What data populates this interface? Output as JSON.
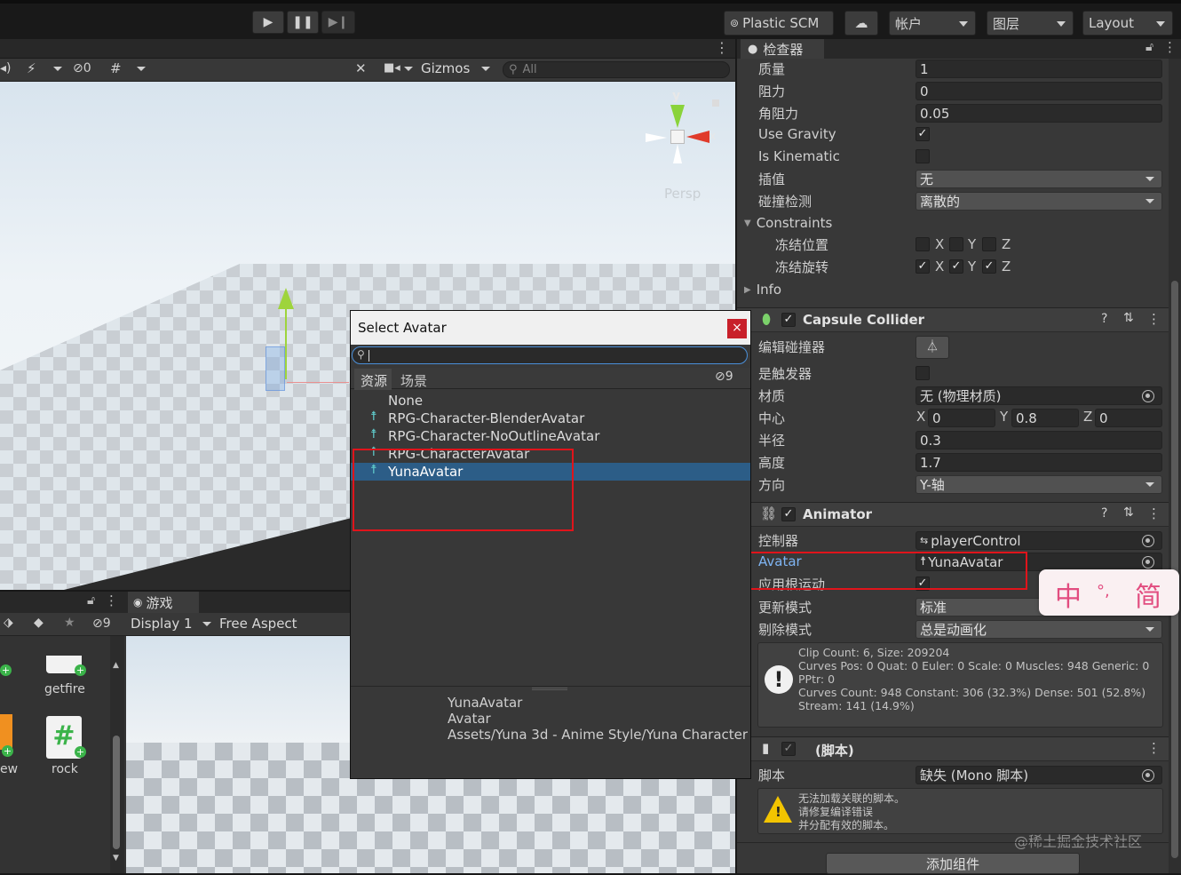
{
  "toolbar": {
    "plastic_scm": "Plastic SCM",
    "account": "帐户",
    "layers": "图层",
    "layout": "Layout"
  },
  "scene_toolbar": {
    "hidden_count": "0",
    "gizmos": "Gizmos",
    "search_placeholder": "All"
  },
  "scene": {
    "axis_y": "y",
    "axis_x": "x",
    "persp": "Persp"
  },
  "inspector": {
    "tab": "检查器",
    "rows": {
      "mass": {
        "label": "质量",
        "value": "1"
      },
      "drag": {
        "label": "阻力",
        "value": "0"
      },
      "angular_drag": {
        "label": "角阻力",
        "value": "0.05"
      },
      "use_gravity": {
        "label": "Use Gravity"
      },
      "is_kinematic": {
        "label": "Is Kinematic"
      },
      "interpolate": {
        "label": "插值",
        "value": "无"
      },
      "collision": {
        "label": "碰撞检测",
        "value": "离散的"
      },
      "constraints": {
        "label": "Constraints"
      },
      "freeze_pos": {
        "label": "冻结位置"
      },
      "freeze_rot": {
        "label": "冻结旋转"
      },
      "info": {
        "label": "Info"
      }
    },
    "axes": {
      "x": "X",
      "y": "Y",
      "z": "Z"
    },
    "capsule": {
      "title": "Capsule Collider",
      "edit_label": "编辑碰撞器",
      "trigger_label": "是触发器",
      "material_label": "材质",
      "material_value": "无 (物理材质)",
      "center_label": "中心",
      "center_x": "0",
      "center_y": "0.8",
      "center_z": "0",
      "radius_label": "半径",
      "radius_value": "0.3",
      "height_label": "高度",
      "height_value": "1.7",
      "direction_label": "方向",
      "direction_value": "Y-轴"
    },
    "animator": {
      "title": "Animator",
      "controller_label": "控制器",
      "controller_value": "playerControl",
      "avatar_label": "Avatar",
      "avatar_value": "YunaAvatar",
      "root_motion_label": "应用根运动",
      "update_label": "更新模式",
      "update_value": "标准",
      "culling_label": "剔除模式",
      "culling_value": "总是动画化",
      "info": [
        "Clip Count: 6, Size: 209204",
        "Curves Pos: 0 Quat: 0 Euler: 0 Scale: 0 Muscles: 948 Generic: 0",
        "PPtr: 0",
        "Curves Count: 948 Constant: 306 (32.3%) Dense: 501 (52.8%)",
        "Stream: 141 (14.9%)"
      ]
    },
    "script": {
      "title": "(脚本)",
      "label": "脚本",
      "value": "缺失 (Mono 脚本)",
      "warning": [
        "无法加载关联的脚本。",
        "请修复编译错误",
        "并分配有效的脚本。"
      ]
    },
    "add_component": "添加组件",
    "watermark": "@稀土掘金技术社区"
  },
  "ime": {
    "a": "中",
    "b": "°,",
    "c": "简"
  },
  "dialog": {
    "title": "Select Avatar",
    "close": "×",
    "tabs": [
      "资源",
      "场景"
    ],
    "hidden_count": "9",
    "items": [
      "None",
      "RPG-Character-BlenderAvatar",
      "RPG-Character-NoOutlineAvatar",
      "RPG-CharacterAvatar",
      "YunaAvatar"
    ],
    "detail": [
      "YunaAvatar",
      "Avatar",
      "Assets/Yuna 3d - Anime Style/Yuna Character"
    ]
  },
  "project": {
    "hidden_count": "9",
    "items": [
      {
        "label": "getfire"
      },
      {
        "label": "ew"
      },
      {
        "label": "rock"
      }
    ]
  },
  "game": {
    "tab": "游戏",
    "display": "Display 1",
    "aspect": "Free Aspect"
  }
}
